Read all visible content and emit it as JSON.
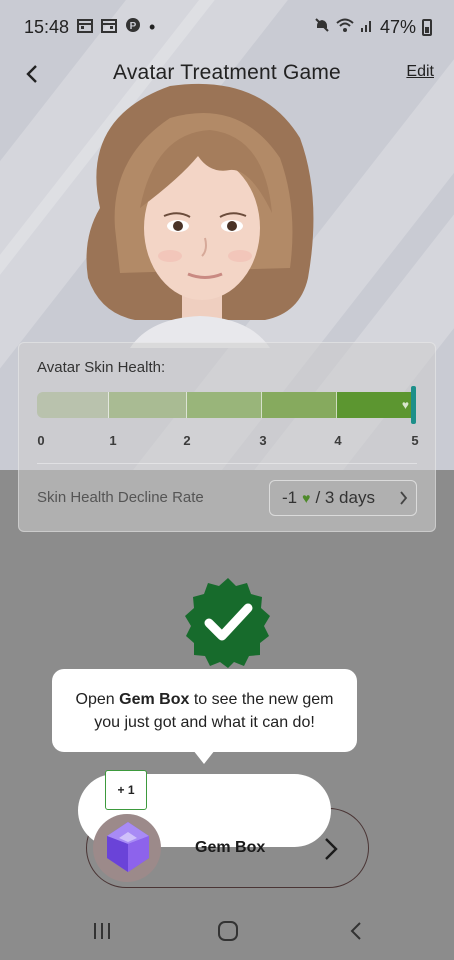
{
  "status_bar": {
    "time": "15:48",
    "dot": "•",
    "battery_percent": "47%",
    "icons": [
      "calendar-icon",
      "calendar-icon",
      "pinterest-icon",
      "mute-icon",
      "wifi-icon",
      "signal-icon",
      "battery-icon"
    ]
  },
  "header": {
    "title": "Avatar Treatment Game",
    "edit_label": "Edit",
    "back_icon": "chevron-left-icon"
  },
  "health_card": {
    "title": "Avatar Skin Health:",
    "level": 5,
    "max_level": 5,
    "ticks": [
      "0",
      "1",
      "2",
      "3",
      "4",
      "5"
    ],
    "decline_label": "Skin Health Decline Rate",
    "decline_prefix": "-1",
    "decline_suffix": "/ 3 days"
  },
  "tooltip": {
    "text_before": "Open ",
    "text_bold": "Gem Box",
    "text_after": " to see the new gem you just got and what it can do!"
  },
  "gem_box": {
    "label": "Gem Box",
    "badge": "+ 1"
  },
  "colors": {
    "health_full": "#5c9630",
    "bar_marker": "#1d8f8a",
    "check_badge": "#176b2c",
    "gem": "#8a5cf0"
  },
  "nav_bar": {
    "icons": [
      "recent-apps-icon",
      "home-icon",
      "back-icon"
    ]
  }
}
